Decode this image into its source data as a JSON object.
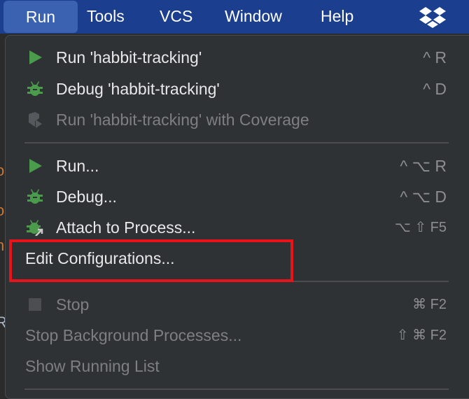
{
  "menubar": {
    "items": [
      "Run",
      "Tools",
      "VCS",
      "Window",
      "Help"
    ],
    "active": "Run"
  },
  "editor_glyphs": [
    "o",
    "o",
    "n",
    "R"
  ],
  "menu": {
    "group1": [
      {
        "label": "Run 'habbit-tracking'",
        "shortcut": "^ R",
        "icon": "play-icon",
        "enabled": true
      },
      {
        "label": "Debug 'habbit-tracking'",
        "shortcut": "^ D",
        "icon": "bug-icon",
        "enabled": true
      },
      {
        "label": "Run 'habbit-tracking' with Coverage",
        "shortcut": "",
        "icon": "coverage-icon",
        "enabled": false
      }
    ],
    "group2": [
      {
        "label": "Run...",
        "shortcut": "^ ⌥ R",
        "icon": "play-icon",
        "enabled": true
      },
      {
        "label": "Debug...",
        "shortcut": "^ ⌥ D",
        "icon": "bug-icon",
        "enabled": true
      },
      {
        "label": "Attach to Process...",
        "shortcut": "⌥ ⇧ F5",
        "icon": "attach-bug-icon",
        "enabled": true
      },
      {
        "label": "Edit Configurations...",
        "shortcut": "",
        "enabled": true
      }
    ],
    "group3": [
      {
        "label": "Stop",
        "shortcut": "⌘ F2",
        "icon": "stop-icon",
        "enabled": false
      },
      {
        "label": "Stop Background Processes...",
        "shortcut": "⇧ ⌘ F2",
        "enabled": false
      },
      {
        "label": "Show Running List",
        "shortcut": "",
        "enabled": false
      }
    ]
  },
  "colors": {
    "menubar": "#1b3f8e",
    "menu_bg": "#2f3235",
    "icon_green": "#4a9c4c",
    "highlight": "#e8141c"
  }
}
